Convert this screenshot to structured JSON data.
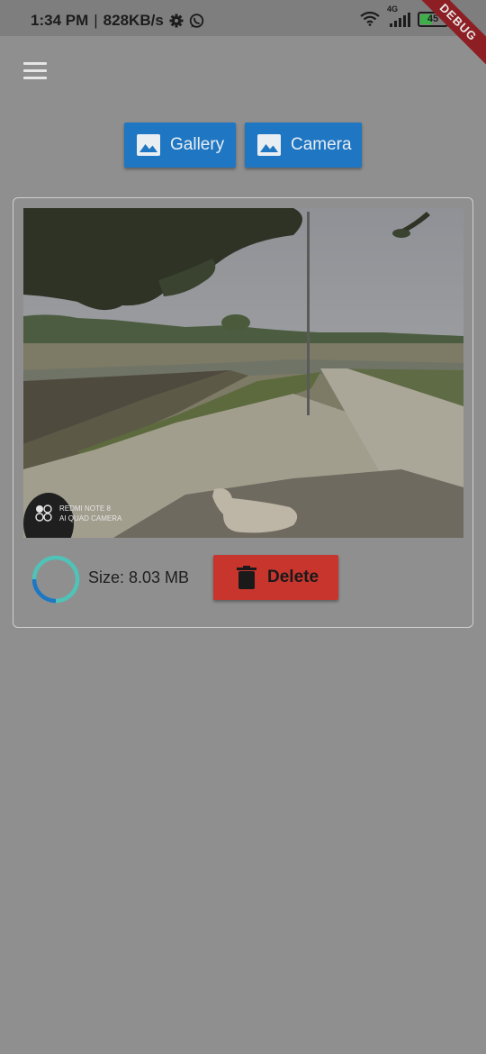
{
  "status_bar": {
    "time": "1:34 PM",
    "separator": "|",
    "network_speed": "828KB/s",
    "network_type": "4G",
    "battery_level": "45",
    "icons": [
      "gear-icon",
      "whatsapp-icon",
      "wifi-icon",
      "signal-icon",
      "battery-icon",
      "charging-icon"
    ]
  },
  "debug_banner": "DEBUG",
  "app_bar": {
    "menu_icon": "menu-icon"
  },
  "actions": {
    "gallery_label": "Gallery",
    "camera_label": "Camera",
    "icon": "image-icon"
  },
  "card": {
    "photo_watermark": {
      "line1": "REDMI NOTE 8",
      "line2": "AI QUAD CAMERA"
    },
    "progress": 0.25,
    "size_text": "Size: 8.03 MB",
    "delete_label": "Delete",
    "delete_icon": "trash-icon"
  },
  "colors": {
    "background": "#8f8f8f",
    "primary_button": "#1f76c2",
    "delete_button": "#c7352d",
    "progress_track": "#4fc3b8",
    "progress_fill": "#1f76c2",
    "debug_banner": "#8d1f24"
  }
}
